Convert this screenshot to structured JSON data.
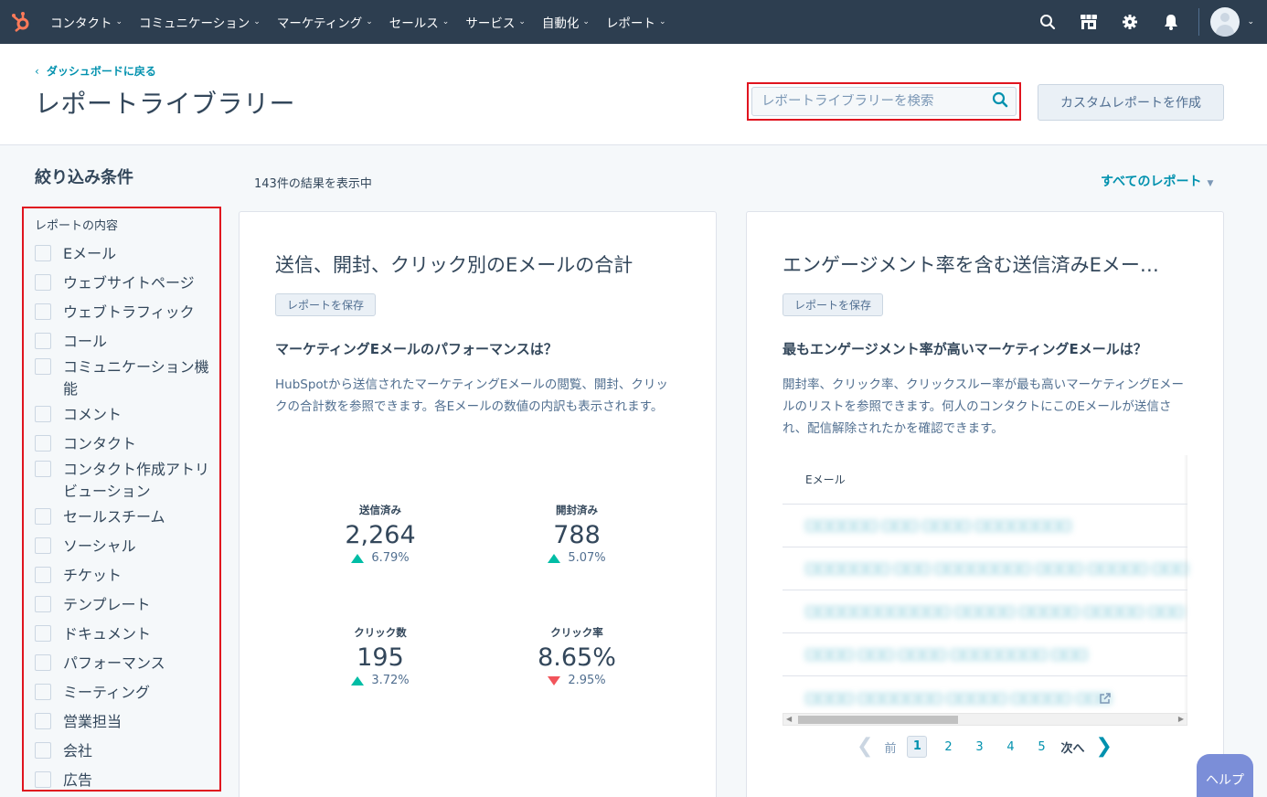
{
  "topnav": {
    "items": [
      {
        "label": "コンタクト"
      },
      {
        "label": "コミュニケーション"
      },
      {
        "label": "マーケティング"
      },
      {
        "label": "セールス"
      },
      {
        "label": "サービス"
      },
      {
        "label": "自動化"
      },
      {
        "label": "レポート"
      }
    ],
    "icons": [
      "search-icon",
      "marketplace-icon",
      "gear-icon",
      "bell-icon"
    ],
    "colors": {
      "background": "#2d3e50",
      "logo": "#ff7a59"
    }
  },
  "header": {
    "back_link": "ダッシュボードに戻る",
    "title": "レポートライブラリー",
    "search_placeholder": "レポートライブラリーを検索",
    "create_button": "カスタムレポートを作成"
  },
  "filters": {
    "title": "絞り込み条件",
    "section_label": "レポートの内容",
    "options": [
      {
        "label": "Eメール"
      },
      {
        "label": "ウェブサイトページ"
      },
      {
        "label": "ウェブトラフィック"
      },
      {
        "label": "コール"
      },
      {
        "label": "コミュニケーション機能"
      },
      {
        "label": "コメント"
      },
      {
        "label": "コンタクト"
      },
      {
        "label": "コンタクト作成アトリビューション"
      },
      {
        "label": "セールスチーム"
      },
      {
        "label": "ソーシャル"
      },
      {
        "label": "チケット"
      },
      {
        "label": "テンプレート"
      },
      {
        "label": "ドキュメント"
      },
      {
        "label": "パフォーマンス"
      },
      {
        "label": "ミーティング"
      },
      {
        "label": "営業担当"
      },
      {
        "label": "会社"
      },
      {
        "label": "広告"
      }
    ]
  },
  "results": {
    "count_text": "143件の結果を表示中",
    "all_reports": "すべてのレポート"
  },
  "cards": [
    {
      "title": "送信、開封、クリック別のEメールの合計",
      "save_button": "レポートを保存",
      "question": "マーケティングEメールのパフォーマンスは？",
      "description": "HubSpotから送信されたマーケティングEメールの閲覧、開封、クリックの合計数を参照できます。各Eメールの数値の内訳も表示されます。",
      "metrics": [
        {
          "label": "送信済み",
          "value": "2,264",
          "delta": "6.79%",
          "direction": "up"
        },
        {
          "label": "開封済み",
          "value": "788",
          "delta": "5.07%",
          "direction": "up"
        },
        {
          "label": "クリック数",
          "value": "195",
          "delta": "3.72%",
          "direction": "up"
        },
        {
          "label": "クリック率",
          "value": "8.65%",
          "delta": "2.95%",
          "direction": "down"
        }
      ]
    },
    {
      "title": "エンゲージメント率を含む送信済みEメー…",
      "save_button": "レポートを保存",
      "question": "最もエンゲージメント率が高いマーケティングEメールは？",
      "description": "開封率、クリック率、クリックスルー率が最も高いマーケティングEメールのリストを参照できます。何人のコンタクトにこのEメールが送信され、配信解除されたかを確認できます。",
      "table": {
        "header": "Eメール",
        "rows": [
          {
            "text": "□□□□□□ □□□ □□□□ □□□□□□□□"
          },
          {
            "text": "□□□□□□□ □□□ □□□□□□□□ □□□□ □□□□□ □□□"
          },
          {
            "text": "□□□□□□□□□□□□ □□□□□ □□□□□ □□□□□ □□□"
          },
          {
            "text": "□□□□ □□□ □□□□ □□□□□□□□ □□□"
          },
          {
            "text": "□□□□ □□□□□□□ □□□□□ □□□□□ □□□"
          }
        ]
      },
      "pagination": {
        "prev": "前",
        "pages": [
          "1",
          "2",
          "3",
          "4",
          "5"
        ],
        "current": "1",
        "next": "次へ"
      }
    }
  ],
  "help_button": "ヘルプ",
  "colors": {
    "accent": "#0091ae",
    "highlight_border": "#e0141f",
    "up": "#00bda5",
    "down": "#f2545b",
    "help": "#7b8ed8"
  }
}
